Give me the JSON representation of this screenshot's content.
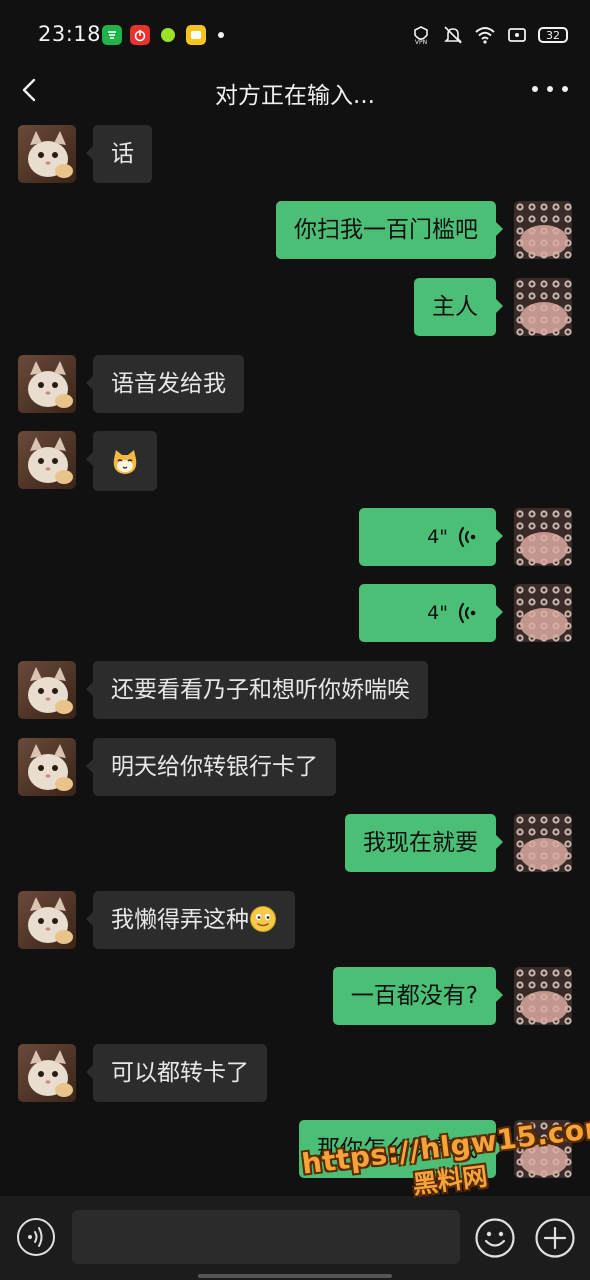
{
  "status_bar": {
    "time": "23:18",
    "app_icons": [
      "wechat-work-icon",
      "netease-music-icon",
      "green-dot-app-icon",
      "yellow-notes-icon"
    ],
    "sys_icons": [
      "vpn-icon",
      "mute-icon",
      "wifi-icon",
      "screen-icon"
    ],
    "vpn_label": "VPN",
    "battery": "32"
  },
  "nav": {
    "title": "对方正在输入..."
  },
  "messages": [
    {
      "side": "left",
      "type": "text",
      "text": "话"
    },
    {
      "side": "right",
      "type": "text",
      "text": "你扫我一百门槛吧"
    },
    {
      "side": "right",
      "type": "text",
      "text": "主人"
    },
    {
      "side": "left",
      "type": "text",
      "text": "语音发给我"
    },
    {
      "side": "left",
      "type": "emoji",
      "text": "cat-face-emoji"
    },
    {
      "side": "right",
      "type": "voice",
      "duration": "4\""
    },
    {
      "side": "right",
      "type": "voice",
      "duration": "4\""
    },
    {
      "side": "left",
      "type": "text",
      "text": "还要看看乃子和想听你娇喘唉"
    },
    {
      "side": "left",
      "type": "text",
      "text": "明天给你转银行卡了"
    },
    {
      "side": "right",
      "type": "text",
      "text": "我现在就要"
    },
    {
      "side": "left",
      "type": "text",
      "text": "我懒得弄这种",
      "trailing_emoji": "smiling-face-emoji"
    },
    {
      "side": "right",
      "type": "text",
      "text": "一百都没有?"
    },
    {
      "side": "left",
      "type": "text",
      "text": "可以都转卡了"
    },
    {
      "side": "right",
      "type": "text",
      "text": "那你怎么保养我"
    }
  ],
  "input_bar": {
    "left_icon": "voice-toggle-icon",
    "emoji_icon": "emoji-icon",
    "plus_icon": "plus-icon"
  },
  "watermark": {
    "url": "https://hlgw15.com",
    "name": "黑料网"
  },
  "colors": {
    "background": "#111111",
    "bubble_left": "#2c2c2c",
    "bubble_right": "#4cbf76",
    "watermark": "#f6a33a"
  }
}
